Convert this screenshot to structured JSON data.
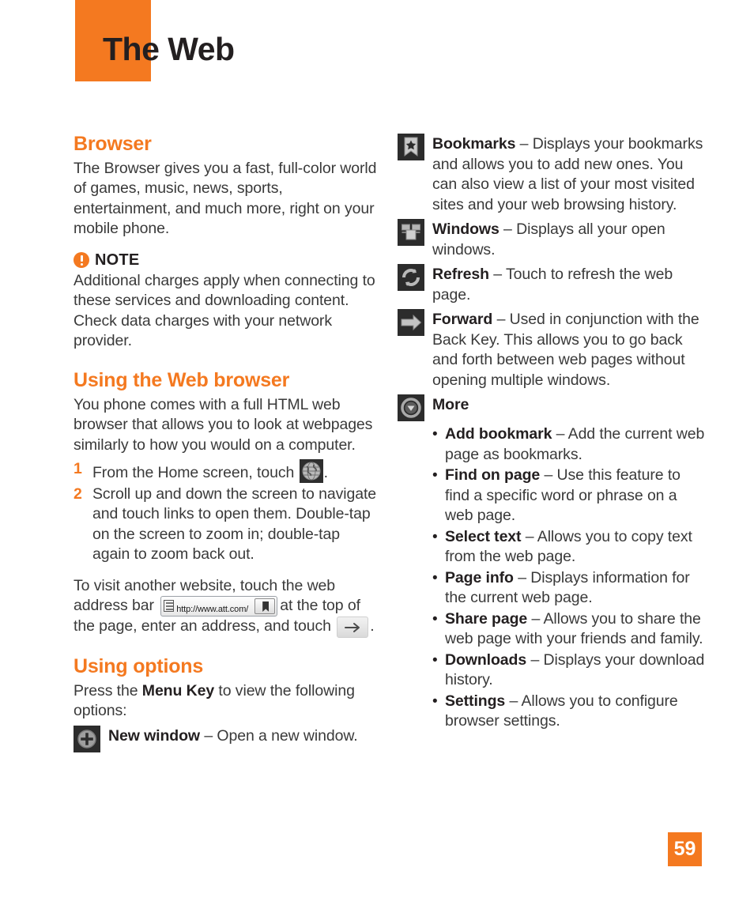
{
  "header": {
    "title": "The Web",
    "accent_color": "#f47920"
  },
  "left_column": {
    "browser_heading": "Browser",
    "browser_body": "The Browser gives you a fast, full-color world of games, music, news, sports, entertainment, and much more, right on your mobile phone.",
    "note_label": "NOTE",
    "note_body": "Additional charges apply when connecting to these services and downloading content. Check data charges with your network provider.",
    "using_web_heading": "Using the Web browser",
    "using_web_body": "You phone comes with a full HTML web browser that allows you to look at webpages similarly to how you would on a computer.",
    "steps": [
      {
        "num": "1",
        "text_before": "From the Home screen, touch",
        "icon": "globe-icon",
        "text_after": "."
      },
      {
        "num": "2",
        "text": "Scroll up and down the screen to navigate and touch links to open them. Double-tap on the screen to zoom in; double-tap again to zoom back out."
      }
    ],
    "visit_text_1": "To visit another website, touch the web address bar",
    "address_bar_url": "http://www.att.com/",
    "visit_text_2": "at the top of the page, enter an address, and touch",
    "visit_text_3": ".",
    "using_options_heading": "Using options",
    "press_menu_before": "Press the ",
    "press_menu_bold": "Menu Key",
    "press_menu_after": " to view the following options:",
    "new_window": {
      "icon": "plus-circle-icon",
      "label": "New window",
      "dash": "–",
      "desc": "Open a new window."
    }
  },
  "right_column": {
    "options": [
      {
        "icon": "bookmark-star-icon",
        "label": "Bookmarks",
        "dash": "–",
        "desc": "Displays your bookmarks and allows you to add new ones. You can also view a list of your most visited sites and your web browsing history."
      },
      {
        "icon": "windows-icon",
        "label": "Windows",
        "dash": "–",
        "desc": "Displays all your open windows."
      },
      {
        "icon": "refresh-icon",
        "label": "Refresh",
        "dash": "–",
        "desc": "Touch to refresh the web page."
      },
      {
        "icon": "forward-arrow-icon",
        "label": "Forward",
        "dash": "–",
        "desc": "Used in conjunction with the Back Key. This allows you to go back and forth between web pages without opening multiple windows."
      },
      {
        "icon": "more-chevron-icon",
        "label": "More",
        "dash": "",
        "desc": ""
      }
    ],
    "more_items": [
      {
        "label": "Add bookmark",
        "dash": "–",
        "desc": "Add the current web page as bookmarks."
      },
      {
        "label": "Find on page",
        "dash": "–",
        "desc": "Use this feature to find a specific word or phrase on a web page."
      },
      {
        "label": "Select text",
        "dash": "–",
        "desc": "Allows you to copy text from the web page."
      },
      {
        "label": "Page info",
        "dash": "–",
        "desc": "Displays information for the current web page."
      },
      {
        "label": "Share page",
        "dash": "–",
        "desc": "Allows you to share the web page with your friends and family."
      },
      {
        "label": "Downloads",
        "dash": "–",
        "desc": "Displays your download history."
      },
      {
        "label": "Settings",
        "dash": "–",
        "desc": "Allows you to configure browser settings."
      }
    ]
  },
  "footer": {
    "page_number": "59"
  }
}
